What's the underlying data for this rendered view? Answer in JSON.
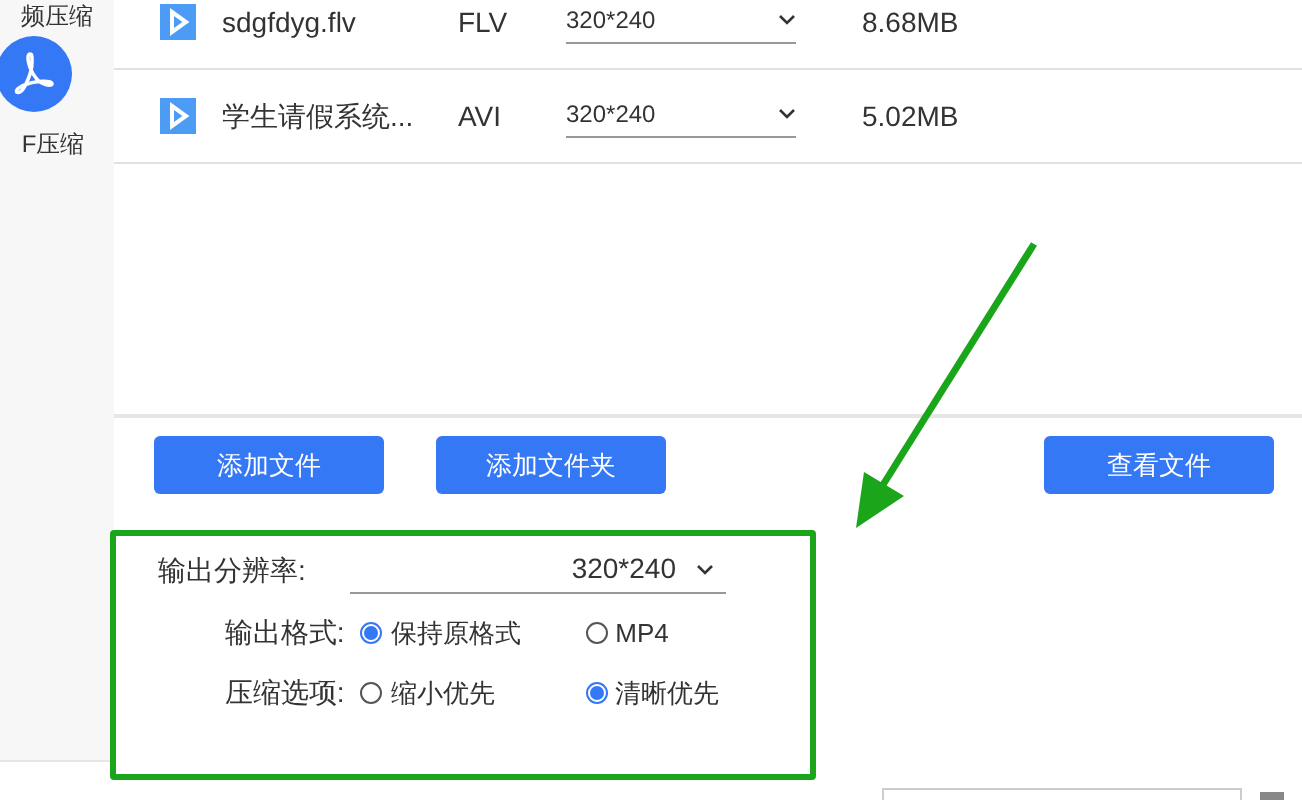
{
  "sidebar": {
    "items": [
      {
        "label": "频压缩",
        "kind": "partial"
      },
      {
        "label": "F压缩",
        "kind": "pdf"
      }
    ]
  },
  "files": [
    {
      "name": "sdgfdyg.flv",
      "format": "FLV",
      "resolution": "320*240",
      "size": "8.68MB"
    },
    {
      "name": "学生请假系统...",
      "format": "AVI",
      "resolution": "320*240",
      "size": "5.02MB"
    }
  ],
  "buttons": {
    "left": [
      "添加文件",
      "添加文件夹"
    ],
    "right": [
      "查看文件"
    ]
  },
  "settings": {
    "resolution_label": "输出分辨率:",
    "resolution": "320*240",
    "groups": [
      {
        "label": "输出格式:",
        "options": [
          {
            "label": "保持原格式",
            "selected": true
          },
          {
            "label": "MP4",
            "selected": false
          }
        ]
      },
      {
        "label": "压缩选项:",
        "options": [
          {
            "label": "缩小优先",
            "selected": false
          },
          {
            "label": "清晰优先",
            "selected": true
          }
        ]
      }
    ]
  }
}
